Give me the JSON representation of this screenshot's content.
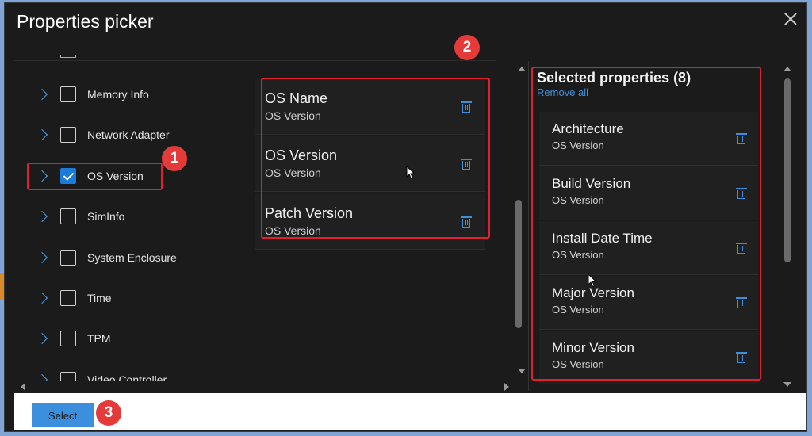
{
  "dialog": {
    "title": "Properties picker",
    "close_icon": "close-icon"
  },
  "tree": {
    "items": [
      {
        "label": "Memory Info",
        "checked": false
      },
      {
        "label": "Network Adapter",
        "checked": false
      },
      {
        "label": "OS Version",
        "checked": true
      },
      {
        "label": "SimInfo",
        "checked": false
      },
      {
        "label": "System Enclosure",
        "checked": false
      },
      {
        "label": "Time",
        "checked": false
      },
      {
        "label": "TPM",
        "checked": false
      },
      {
        "label": "Video Controller",
        "checked": false
      }
    ]
  },
  "middle": {
    "items": [
      {
        "title": "OS Name",
        "sub": "OS Version"
      },
      {
        "title": "OS Version",
        "sub": "OS Version"
      },
      {
        "title": "Patch Version",
        "sub": "OS Version"
      }
    ]
  },
  "selected": {
    "title": "Selected properties (8)",
    "remove_all": "Remove all",
    "items": [
      {
        "title": "Architecture",
        "sub": "OS Version"
      },
      {
        "title": "Build Version",
        "sub": "OS Version"
      },
      {
        "title": "Install Date Time",
        "sub": "OS Version"
      },
      {
        "title": "Major Version",
        "sub": "OS Version"
      },
      {
        "title": "Minor Version",
        "sub": "OS Version"
      }
    ]
  },
  "footer": {
    "select_label": "Select"
  },
  "badges": {
    "one": "1",
    "two": "2",
    "three": "3"
  },
  "colors": {
    "accent": "#3b8fdc",
    "highlight": "#e0202e",
    "badge": "#e53a3a"
  }
}
